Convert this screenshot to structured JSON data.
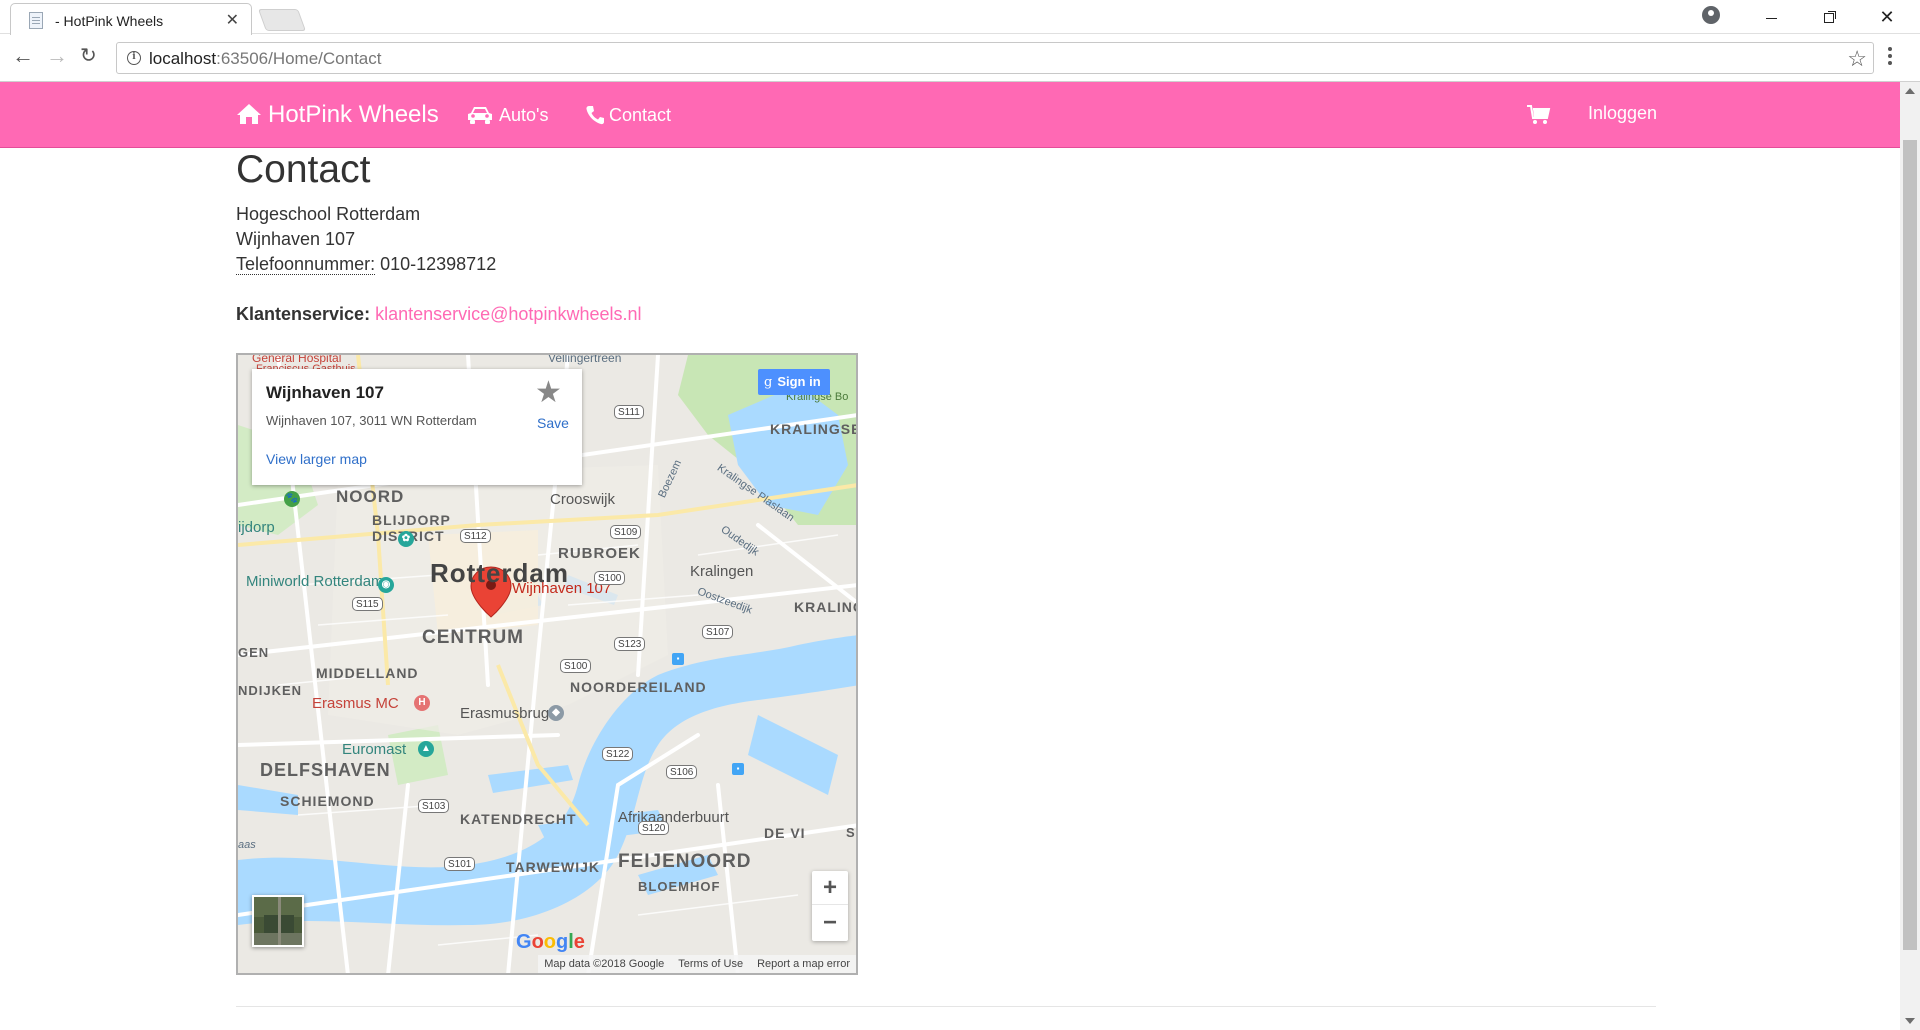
{
  "browser": {
    "tab_title": "- HotPink Wheels",
    "url_host": "localhost",
    "url_rest": ":63506/Home/Contact"
  },
  "site": {
    "brand": "HotPink Wheels",
    "nav_autos": "Auto's",
    "nav_contact": "Contact",
    "nav_login": "Inloggen",
    "accent_color": "#ff69b4"
  },
  "contact": {
    "title": "Contact",
    "address_line1": "Hogeschool Rotterdam",
    "address_line2": "Wijnhaven 107",
    "phone_label": "Telefoonnummer:",
    "phone": "010-12398712",
    "service_label": "Klantenservice:",
    "service_email": "klantenservice@hotpinkwheels.nl"
  },
  "map": {
    "card": {
      "place_name": "Wijnhaven 107",
      "place_address": "Wijnhaven 107, 3011 WN Rotterdam",
      "save": "Save",
      "view_larger": "View larger map"
    },
    "signin": "Sign in",
    "marker_label": "Wijnhaven 107",
    "labels": {
      "noord": "NOORD",
      "blijdorp": "BLIJDORP",
      "district": "DISTRICT",
      "crooswijk": "Crooswijk",
      "kralingse": "KRALINGSE",
      "kralingse_bos": "Kralingse Bo",
      "rubroek": "RUBROEK",
      "kralingen": "Kralingen",
      "kraling": "KRALING",
      "rotterdam": "Rotterdam",
      "centrum": "CENTRUM",
      "middelland": "MIDDELLAND",
      "noordereiland": "NOORDEREILAND",
      "erasmus_mc": "Erasmus MC",
      "erasmusbrug": "Erasmusbrug",
      "euromast": "Euromast",
      "delfshaven": "DELFSHAVEN",
      "schiemond": "SCHIEMOND",
      "katendrecht": "KATENDRECHT",
      "afrikaanderbuurt": "Afrikaanderbuurt",
      "tarwewijk": "TARWEWIJK",
      "feijenoord": "FEIJENOORD",
      "bloemhof": "BLOEMHOF",
      "de_vi": "DE VI",
      "miniworld": "Miniworld Rotterdam",
      "ijdorp": "ijdorp",
      "gen": "GEN",
      "ndijken": "NDIJKEN",
      "aas": "aas",
      "general_hosp": "General Hospital",
      "franciscus": "Franciscus Gasthuis",
      "vellingertreen": "Vellingertreen",
      "boezem": "Boezem",
      "kralingse_plaslaan": "Kralingse Plaslaan",
      "oudedijk": "Oudedijk",
      "oostzeedijk": "Oostzeedijk",
      "s_right": "S"
    },
    "shields": [
      "S111",
      "S112",
      "S109",
      "S100",
      "S115",
      "S107",
      "S123",
      "S100",
      "S122",
      "S106",
      "S103",
      "S120",
      "S101"
    ],
    "google_letters": [
      "G",
      "o",
      "o",
      "g",
      "l",
      "e"
    ],
    "attribution": {
      "data": "Map data ©2018 Google",
      "terms": "Terms of Use",
      "report": "Report a map error"
    }
  }
}
